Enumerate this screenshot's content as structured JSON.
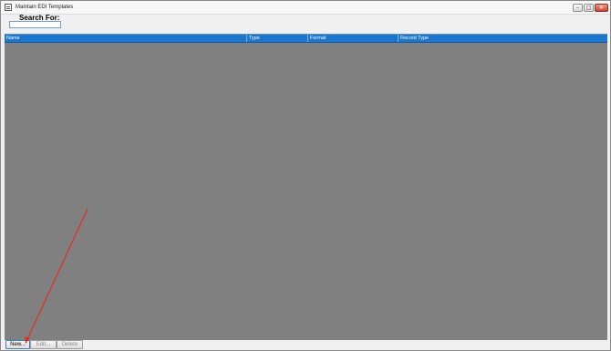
{
  "window": {
    "title": "Maintain EDI Templates",
    "controls": {
      "minimize": "–",
      "maximize": "□",
      "close": "✕"
    }
  },
  "search": {
    "label": "Search For:",
    "value": "",
    "placeholder": ""
  },
  "grid": {
    "columns": [
      "Name",
      "Type",
      "Format",
      "Record Type"
    ],
    "rows": []
  },
  "buttons": {
    "new": "New...",
    "edit": "Edit...",
    "delete": "Delete"
  },
  "colors": {
    "header_blue": "#1b76d0",
    "grid_background": "#808080",
    "annotation_arrow": "#d9342b"
  }
}
